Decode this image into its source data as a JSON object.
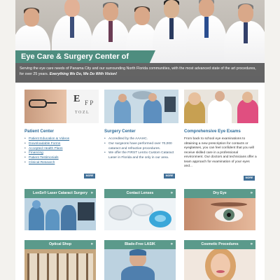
{
  "hero": {
    "heading": "Eye Care & Surgery Center of Excellence",
    "blurb": "Serving the eye care needs of Panama City and our surrounding North Florida communities, with the most advanced state of the art procedures, for over 25 years.",
    "tagline": "Everything We Do, We Do With Vision!"
  },
  "columns": {
    "patient": {
      "title": "Patient Center",
      "links": [
        "Patient Education & Videos",
        "Downloadable Forms",
        "Accepted Health Plans",
        "Financing",
        "Patient Testimonials",
        "Clinical Research"
      ],
      "more": "MORE"
    },
    "surgery": {
      "title": "Surgery Center",
      "bullets": [
        "Accredited by the AAAHC.",
        "Our surgeons have performed over 70,000 cataract and refractive procedures.",
        "We offer the FIRST LenSx Custom Cataract Laser in Florida and the only in our area."
      ],
      "more": "MORE"
    },
    "exams": {
      "title": "Comprehensive Eye Exams",
      "text": "From back to school eye examinations to obtaining a new prescription for contacts or eyeglasses, you can feel confident that you will receive skilled care in a professional environment. Our doctors and technicians offer a team approach for examination of your eyes and...",
      "more": "MORE"
    }
  },
  "tiles": [
    {
      "label": "LenSx® Laser Cataract Surgery"
    },
    {
      "label": "Contact Lenses"
    },
    {
      "label": "Dry Eye"
    },
    {
      "label": "Optical Shop"
    },
    {
      "label": "Blade-Free LASIK"
    },
    {
      "label": "Cosmetic Procedures"
    }
  ],
  "icons": {
    "chevron": "chevron-right-icon"
  },
  "colors": {
    "accent": "#5b9a8b",
    "link": "#2f6d9a",
    "button": "#3f6e96"
  }
}
